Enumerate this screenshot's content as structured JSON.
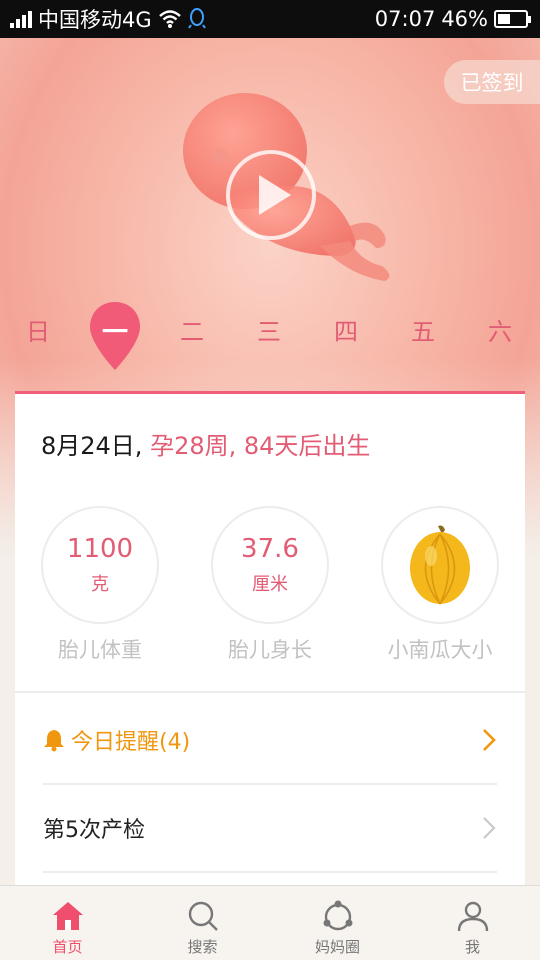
{
  "status_bar": {
    "carrier": "中国移动4G",
    "time": "07:07",
    "battery_percent": "46%"
  },
  "hero": {
    "checkin_label": "已签到"
  },
  "week": {
    "days": [
      "日",
      "一",
      "二",
      "三",
      "四",
      "五",
      "六"
    ],
    "selected": "一"
  },
  "summary": {
    "date": "8月24日,",
    "pregnancy_info": "孕28周, 84天后出生"
  },
  "stats": [
    {
      "value": "1100",
      "unit": "克",
      "label": "胎儿体重"
    },
    {
      "value": "37.6",
      "unit": "厘米",
      "label": "胎儿身长"
    },
    {
      "value": "",
      "unit": "",
      "label": "小南瓜大小"
    }
  ],
  "reminder": {
    "label": "今日提醒(4)"
  },
  "exam": {
    "label": "第5次产检"
  },
  "nav": {
    "home": "首页",
    "search": "搜索",
    "circle": "妈妈圈",
    "me": "我"
  },
  "colors": {
    "accent": "#e25c74",
    "reminder": "#f0960f",
    "nav_active": "#ef4f6c"
  }
}
